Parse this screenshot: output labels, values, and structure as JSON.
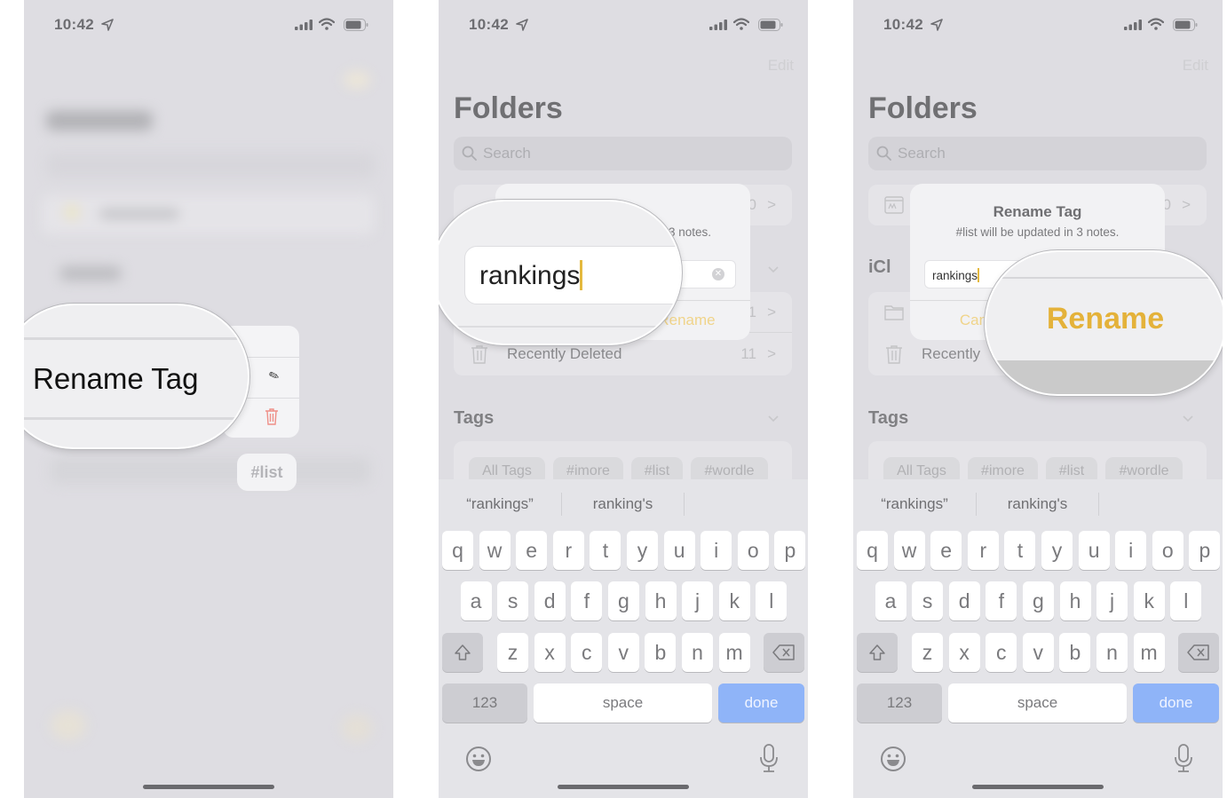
{
  "status_bar": {
    "time": "10:42"
  },
  "panel1": {
    "magnified_label": "Rename Tag",
    "tag_chip": "#list"
  },
  "notes": {
    "edit_label": "Edit",
    "title": "Folders",
    "search_placeholder": "Search",
    "folders": [
      {
        "name": "Recently Deleted",
        "count": "11"
      }
    ],
    "partial_counts": [
      "0",
      "1"
    ],
    "icloud_header_partial": "iCl",
    "tags_header": "Tags",
    "tags": [
      "All Tags",
      "#imore",
      "#list",
      "#wordle"
    ]
  },
  "alert": {
    "title": "Rename Tag",
    "message": "#list will be updated in 3 notes.",
    "input_value": "rankings",
    "cancel_label": "Cancel",
    "rename_label": "Rename",
    "accent_color": "#e4b23a"
  },
  "panel2": {
    "alert_title_partial": "Tag",
    "alert_message_partial": "3 notes.",
    "rename_partial": "Rename"
  },
  "panel3": {
    "cancel_partial": "Can",
    "recently_partial": "Recently"
  },
  "keyboard": {
    "predictions": [
      "“rankings”",
      "ranking's"
    ],
    "row1": [
      "q",
      "w",
      "e",
      "r",
      "t",
      "y",
      "u",
      "i",
      "o",
      "p"
    ],
    "row2": [
      "a",
      "s",
      "d",
      "f",
      "g",
      "h",
      "j",
      "k",
      "l"
    ],
    "row3": [
      "z",
      "x",
      "c",
      "v",
      "b",
      "n",
      "m"
    ],
    "numbers_label": "123",
    "space_label": "space",
    "done_label": "done"
  }
}
